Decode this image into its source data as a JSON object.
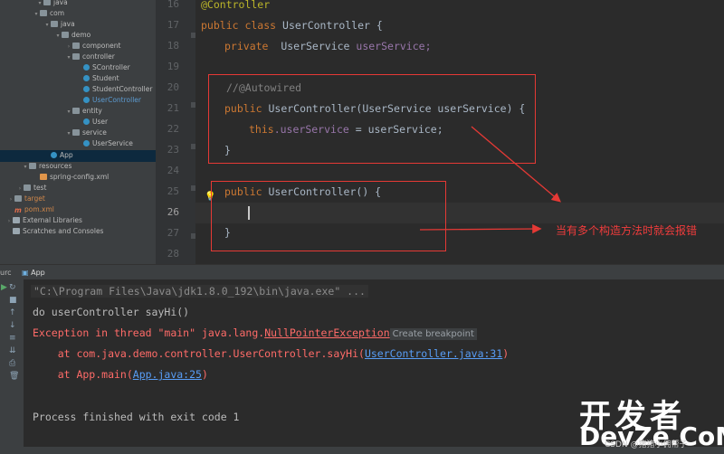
{
  "project_tree": {
    "items": [
      {
        "label": "java",
        "kind": "folder",
        "arrow": "▾",
        "tone": ""
      },
      {
        "label": "com",
        "kind": "pkg",
        "arrow": "▾",
        "tone": ""
      },
      {
        "label": "java",
        "kind": "pkg",
        "arrow": "▾",
        "tone": ""
      },
      {
        "label": "demo",
        "kind": "pkg",
        "arrow": "▾",
        "tone": ""
      },
      {
        "label": "component",
        "kind": "pkg",
        "arrow": "›",
        "tone": ""
      },
      {
        "label": "controller",
        "kind": "pkg",
        "arrow": "▾",
        "tone": ""
      },
      {
        "label": "SController",
        "kind": "cls",
        "arrow": "",
        "tone": ""
      },
      {
        "label": "Student",
        "kind": "cls",
        "arrow": "",
        "tone": ""
      },
      {
        "label": "StudentController",
        "kind": "cls",
        "arrow": "",
        "tone": ""
      },
      {
        "label": "UserController",
        "kind": "cls",
        "arrow": "",
        "tone": "blue"
      },
      {
        "label": "entity",
        "kind": "pkg",
        "arrow": "▾",
        "tone": ""
      },
      {
        "label": "User",
        "kind": "cls",
        "arrow": "",
        "tone": ""
      },
      {
        "label": "service",
        "kind": "pkg",
        "arrow": "▾",
        "tone": ""
      },
      {
        "label": "UserService",
        "kind": "cls",
        "arrow": "",
        "tone": ""
      },
      {
        "label": "App",
        "kind": "cls",
        "arrow": "",
        "tone": ""
      },
      {
        "label": "resources",
        "kind": "folder",
        "arrow": "▾",
        "tone": ""
      },
      {
        "label": "spring-config.xml",
        "kind": "xml",
        "arrow": "",
        "tone": ""
      },
      {
        "label": "test",
        "kind": "folder",
        "arrow": "›",
        "tone": ""
      },
      {
        "label": "target",
        "kind": "folder",
        "arrow": "›",
        "tone": "orange"
      },
      {
        "label": "pom.xml",
        "kind": "mvn",
        "arrow": "",
        "tone": "orange"
      },
      {
        "label": "External Libraries",
        "kind": "lib",
        "arrow": "›",
        "tone": ""
      },
      {
        "label": "Scratches and Consoles",
        "kind": "lib",
        "arrow": "",
        "tone": ""
      }
    ]
  },
  "editor": {
    "line_numbers": [
      "16",
      "17",
      "18",
      "19",
      "20",
      "21",
      "22",
      "23",
      "24",
      "25",
      "26",
      "27",
      "28"
    ],
    "current_line": "26",
    "code": {
      "l16": "@Controller",
      "l17_kw": "public class ",
      "l17_name": "UserController {",
      "l18_kw": "private  ",
      "l18_type": "UserService ",
      "l18_field": "userService;",
      "l20": "//@Autowired",
      "l21_kw": "public ",
      "l21_name": "UserController",
      "l21_rest": "(UserService userService) {",
      "l22_kw": "this",
      "l22_field": ".userService",
      "l22_rest": " = userService;",
      "l23": "}",
      "l25_kw": "public ",
      "l25_name": "UserController",
      "l25_rest": "() {",
      "l27": "}"
    },
    "annotation_note": "当有多个构造方法时就会报错"
  },
  "run_panel": {
    "prefix": "urc",
    "tab_label": "App",
    "lines": {
      "cmd": "\"C:\\Program Files\\Java\\jdk1.8.0_192\\bin\\java.exe\" ...",
      "out1": "do userController sayHi()",
      "exc_prefix": "Exception in thread \"main\" java.lang.",
      "exc_class": "NullPointerException",
      "breakpoint_hint": "Create breakpoint",
      "at1_prefix": "    at com.java.demo.controller.UserController.sayHi(",
      "at1_link": "UserController.java:31",
      "at1_suffix": ")",
      "at2_prefix": "    at App.main(",
      "at2_link": "App.java:25",
      "at2_suffix": ")",
      "finish": "Process finished with exit code 1"
    }
  },
  "watermark": {
    "top": "开发者",
    "bottom": "DevZe.CoM",
    "csdn": "CSDN @猪猪小佣帮子"
  },
  "colors": {
    "keyword": "#cc7832",
    "field": "#9876aa",
    "annotation": "#bbb529",
    "error": "#ff6b68",
    "link": "#589df6",
    "red_box": "#e53935"
  }
}
